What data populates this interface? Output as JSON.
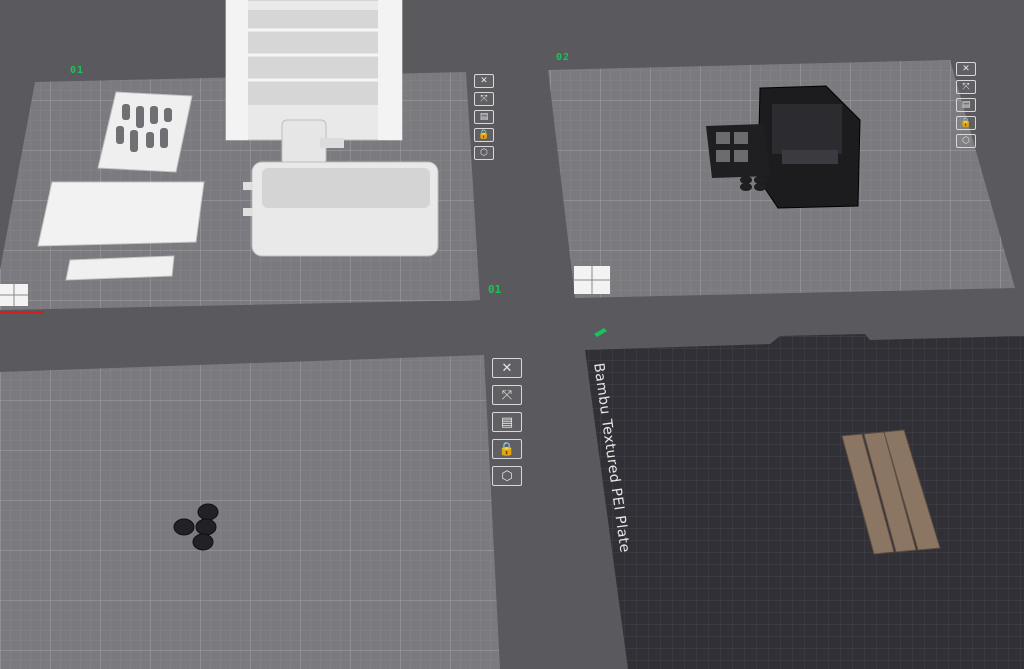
{
  "app": {
    "view": "3D plate overview"
  },
  "plates": [
    {
      "id": "plate-top-left",
      "number_label": "01",
      "index_label": "01"
    },
    {
      "id": "plate-top-right",
      "index_label": "02"
    },
    {
      "id": "plate-bottom-left",
      "index_label": "03"
    },
    {
      "id": "plate-bottom-right",
      "index_label": "04",
      "surface_text": "Bambu Textured PEI Plate"
    }
  ],
  "plate_tools": [
    {
      "name": "close",
      "glyph": "✕"
    },
    {
      "name": "arrange",
      "glyph": "⤧"
    },
    {
      "name": "layout",
      "glyph": "▤"
    },
    {
      "name": "lock",
      "glyph": "🔒"
    },
    {
      "name": "settings",
      "glyph": "⬡"
    }
  ],
  "colors": {
    "background": "#5a5a5e",
    "plate_grey": "#7b7b80",
    "plate_dark": "#2f2f35",
    "accent_green": "#19c35a",
    "model_white": "#eaeaea",
    "model_black": "#1b1b1e",
    "model_wood": "#8a7563"
  }
}
